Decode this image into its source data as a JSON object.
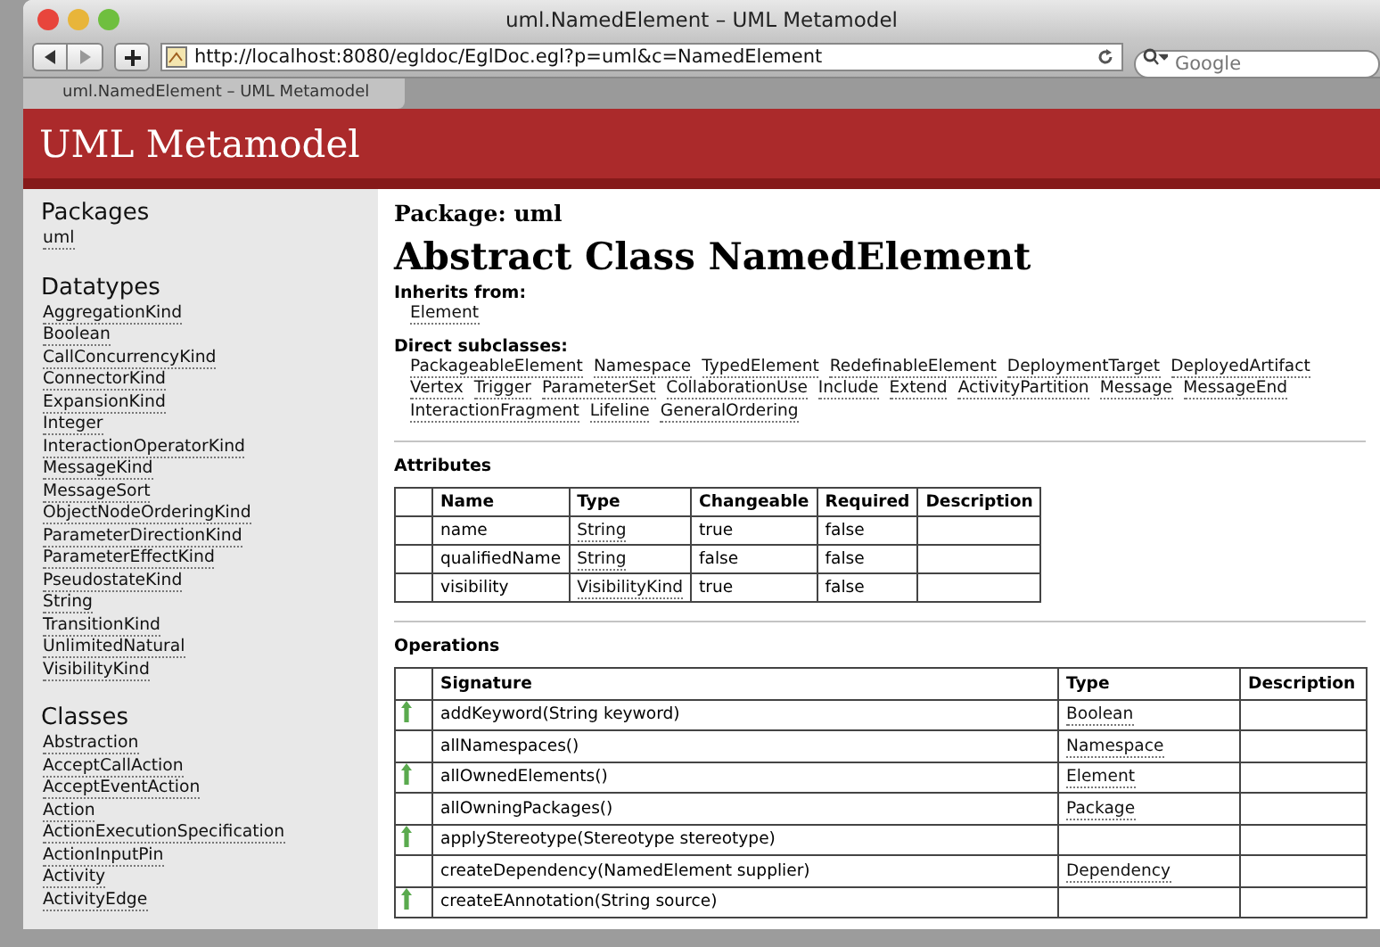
{
  "window": {
    "title": "uml.NamedElement – UML Metamodel"
  },
  "toolbar": {
    "url": "http://localhost:8080/egldoc/EglDoc.egl?p=uml&c=NamedElement",
    "search_placeholder": "Google"
  },
  "tabs": [
    {
      "label": "uml.NamedElement – UML Metamodel",
      "selected": true
    }
  ],
  "header": {
    "title": "UML Metamodel"
  },
  "sidebar": {
    "sections": [
      {
        "title": "Packages",
        "items": [
          "uml"
        ]
      },
      {
        "title": "Datatypes",
        "items": [
          "AggregationKind",
          "Boolean",
          "CallConcurrencyKind",
          "ConnectorKind",
          "ExpansionKind",
          "Integer",
          "InteractionOperatorKind",
          "MessageKind",
          "MessageSort",
          "ObjectNodeOrderingKind",
          "ParameterDirectionKind",
          "ParameterEffectKind",
          "PseudostateKind",
          "String",
          "TransitionKind",
          "UnlimitedNatural",
          "VisibilityKind"
        ]
      },
      {
        "title": "Classes",
        "items": [
          "Abstraction",
          "AcceptCallAction",
          "AcceptEventAction",
          "Action",
          "ActionExecutionSpecification",
          "ActionInputPin",
          "Activity",
          "ActivityEdge"
        ]
      }
    ]
  },
  "content": {
    "package": "Package: uml",
    "title": "Abstract Class NamedElement",
    "inherits_label": "Inherits from:",
    "inherits": [
      "Element"
    ],
    "subclasses_label": "Direct subclasses:",
    "subclass_lines": [
      [
        "PackageableElement",
        "Namespace",
        "TypedElement",
        "RedefinableElement",
        "DeploymentTarget",
        "DeployedArtifact"
      ],
      [
        "Vertex",
        "Trigger",
        "ParameterSet",
        "CollaborationUse",
        "Include",
        "Extend",
        "ActivityPartition",
        "Message",
        "MessageEnd"
      ],
      [
        "InteractionFragment",
        "Lifeline",
        "GeneralOrdering"
      ]
    ],
    "attributes": {
      "title": "Attributes",
      "columns": [
        "Name",
        "Type",
        "Changeable",
        "Required",
        "Description"
      ],
      "rows": [
        {
          "name": "name",
          "type": "String",
          "changeable": "true",
          "required": "false"
        },
        {
          "name": "qualifiedName",
          "type": "String",
          "changeable": "false",
          "required": "false"
        },
        {
          "name": "visibility",
          "type": "VisibilityKind",
          "changeable": "true",
          "required": "false"
        }
      ]
    },
    "operations": {
      "title": "Operations",
      "columns": [
        "Signature",
        "Type",
        "Description"
      ],
      "rows": [
        {
          "inherited": true,
          "signature": "addKeyword(String keyword)",
          "type": "Boolean"
        },
        {
          "inherited": false,
          "signature": "allNamespaces()",
          "type": "Namespace"
        },
        {
          "inherited": true,
          "signature": "allOwnedElements()",
          "type": "Element"
        },
        {
          "inherited": false,
          "signature": "allOwningPackages()",
          "type": "Package"
        },
        {
          "inherited": true,
          "signature": "applyStereotype(Stereotype stereotype)"
        },
        {
          "inherited": false,
          "signature": "createDependency(NamedElement supplier)",
          "type": "Dependency"
        },
        {
          "inherited": true,
          "signature": "createEAnnotation(String source)"
        }
      ]
    }
  }
}
